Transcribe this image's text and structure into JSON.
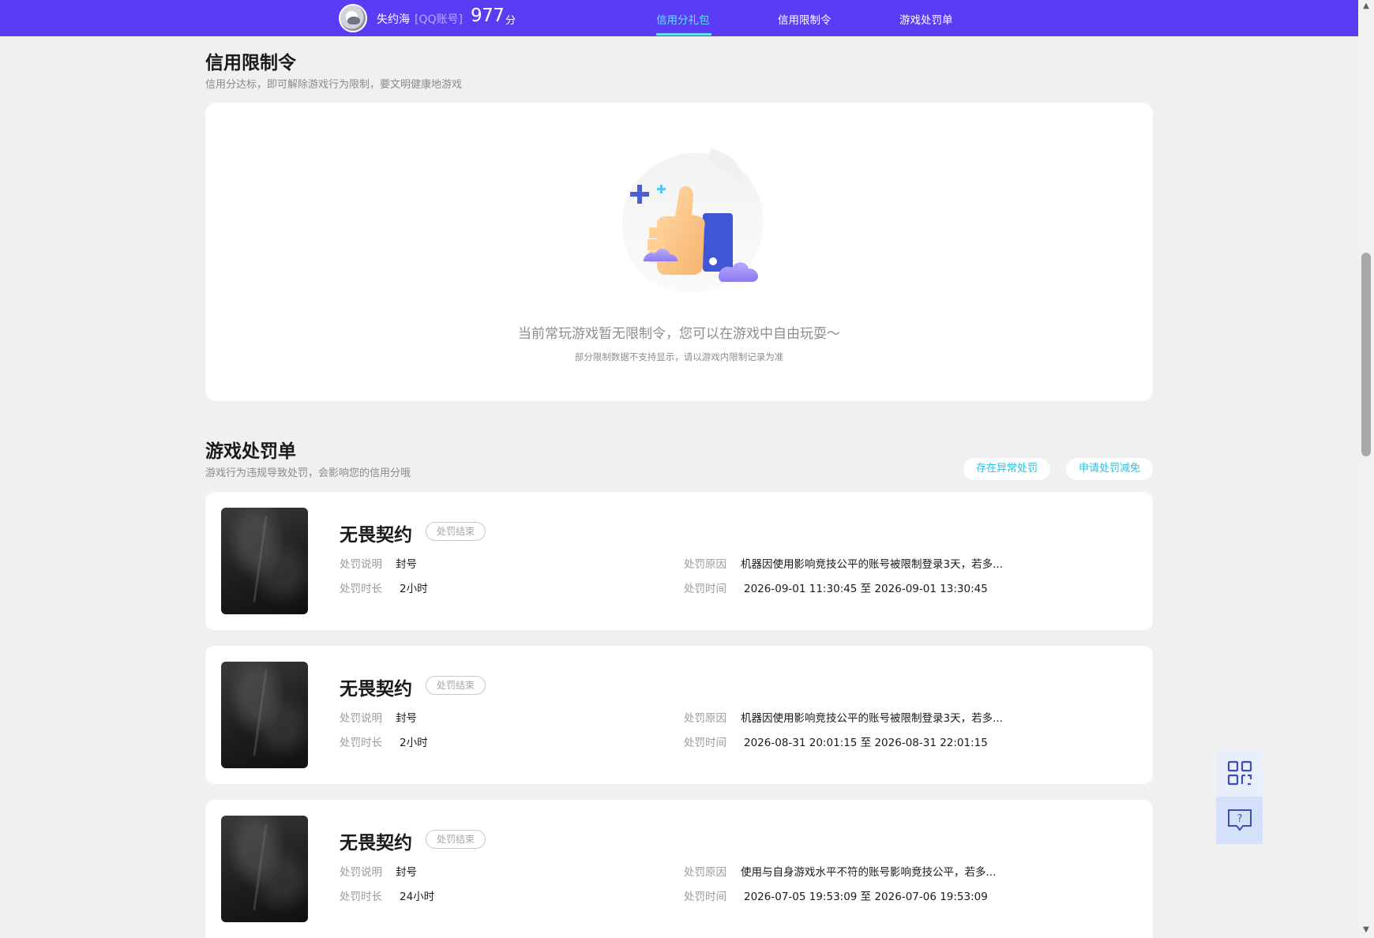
{
  "header": {
    "username": "失约海",
    "account_type": "[QQ账号]",
    "score": "977",
    "score_unit": "分",
    "tabs": [
      {
        "label": "信用分礼包",
        "active": true
      },
      {
        "label": "信用限制令",
        "active": false
      },
      {
        "label": "游戏处罚单",
        "active": false
      }
    ],
    "colors": {
      "bar": "#5a3cf5",
      "active_tab": "#66e0ff"
    }
  },
  "restriction": {
    "title": "信用限制令",
    "subtitle": "信用分达标，即可解除游戏行为限制，要文明健康地游戏",
    "empty_message": "当前常玩游戏暂无限制令，您可以在游戏中自由玩耍～",
    "empty_note": "部分限制数据不支持显示，请以游戏内限制记录为准",
    "illustration_icon": "thumbs-up-icon"
  },
  "penalty": {
    "title": "游戏处罚单",
    "subtitle": "游戏行为违规导致处罚，会影响您的信用分哦",
    "actions": {
      "report_abnormal": "存在异常处罚",
      "apply_reduction": "申请处罚减免"
    },
    "labels": {
      "description": "处罚说明",
      "duration": "处罚时长",
      "reason": "处罚原因",
      "time": "处罚时间"
    },
    "items": [
      {
        "game": "无畏契约",
        "status": "处罚结束",
        "description": "封号",
        "duration": "2小时",
        "reason": "机器因使用影响竞技公平的账号被限制登录3天，若多...",
        "time": "2026-09-01 11:30:45 至 2026-09-01 13:30:45"
      },
      {
        "game": "无畏契约",
        "status": "处罚结束",
        "description": "封号",
        "duration": "2小时",
        "reason": "机器因使用影响竞技公平的账号被限制登录3天，若多...",
        "time": "2026-08-31 20:01:15 至 2026-08-31 22:01:15"
      },
      {
        "game": "无畏契约",
        "status": "处罚结束",
        "description": "封号",
        "duration": "24小时",
        "reason": "使用与自身游戏水平不符的账号影响竞技公平，若多...",
        "time": "2026-07-05 19:53:09 至 2026-07-06 19:53:09"
      }
    ]
  },
  "side_tools": {
    "icons": [
      "qr-code-icon",
      "help-feedback-icon"
    ]
  }
}
